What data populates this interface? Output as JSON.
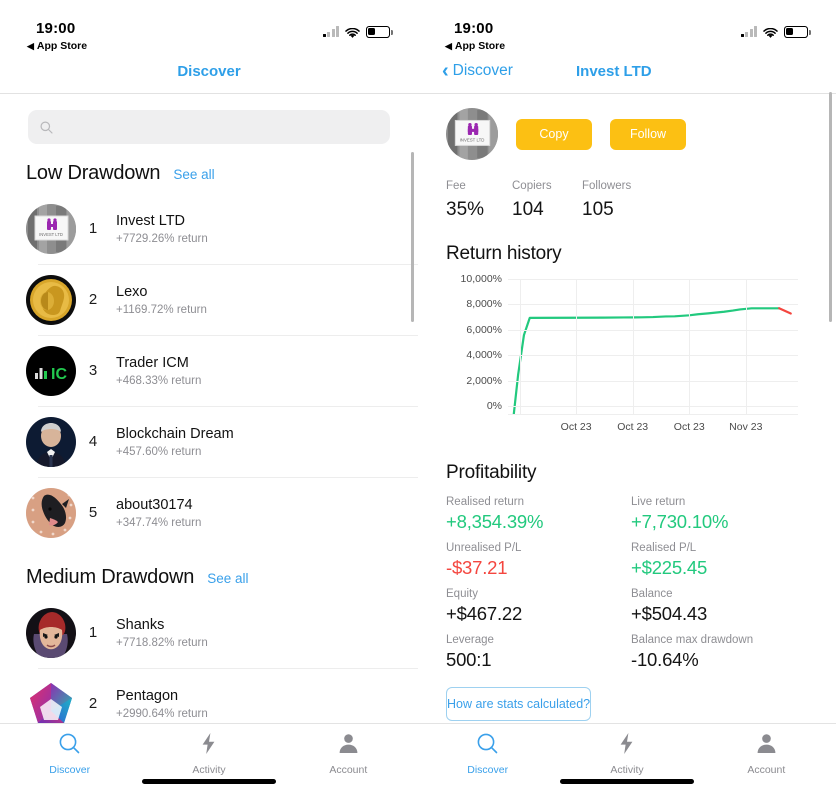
{
  "status_bar": {
    "time": "19:00",
    "back_label": "App Store",
    "back_glyph": "◀"
  },
  "left": {
    "nav_title": "Discover",
    "search": {
      "placeholder": "",
      "value": "",
      "icon": "search-icon"
    },
    "sections": [
      {
        "title": "Low Drawdown",
        "see_all": "See all",
        "items": [
          {
            "rank": "1",
            "name": "Invest LTD",
            "return": "+7729.26% return",
            "avatar": "invest-ltd-logo"
          },
          {
            "rank": "2",
            "name": "Lexo",
            "return": "+1169.72% return",
            "avatar": "gold-coin"
          },
          {
            "rank": "3",
            "name": "Trader ICM",
            "return": "+468.33% return",
            "avatar": "trader-icm-logo"
          },
          {
            "rank": "4",
            "name": "Blockchain Dream",
            "return": "+457.60% return",
            "avatar": "man-portrait"
          },
          {
            "rank": "5",
            "name": "about30174",
            "return": "+347.74% return",
            "avatar": "dog-photo"
          }
        ]
      },
      {
        "title": "Medium Drawdown",
        "see_all": "See all",
        "items": [
          {
            "rank": "1",
            "name": "Shanks",
            "return": "+7718.82% return",
            "avatar": "anime-character"
          },
          {
            "rank": "2",
            "name": "Pentagon",
            "return": "+2990.64% return",
            "avatar": "pentagon-logo"
          }
        ]
      }
    ]
  },
  "right": {
    "nav_back": "Discover",
    "nav_title": "Invest LTD",
    "profile": {
      "avatar": "invest-ltd-logo",
      "copy_label": "Copy",
      "follow_label": "Follow"
    },
    "stats": [
      {
        "key": "Fee",
        "value": "35%"
      },
      {
        "key": "Copiers",
        "value": "104"
      },
      {
        "key": "Followers",
        "value": "105"
      }
    ],
    "return_history_title": "Return history",
    "profitability_title": "Profitability",
    "profitability": [
      {
        "key": "Realised return",
        "value": "+8,354.39%",
        "tone": "green"
      },
      {
        "key": "Live return",
        "value": "+7,730.10%",
        "tone": "green"
      },
      {
        "key": "Unrealised P/L",
        "value": "-$37.21",
        "tone": "red"
      },
      {
        "key": "Realised P/L",
        "value": "+$225.45",
        "tone": "green"
      },
      {
        "key": "Equity",
        "value": "+$467.22",
        "tone": "dark"
      },
      {
        "key": "Balance",
        "value": "+$504.43",
        "tone": "dark"
      },
      {
        "key": "Leverage",
        "value": "500:1",
        "tone": "dark"
      },
      {
        "key": "Balance max drawdown",
        "value": "-10.64%",
        "tone": "dark"
      }
    ],
    "stats_button": "How are stats calculated?"
  },
  "tabbar": {
    "items": [
      {
        "label": "Discover",
        "icon": "search-icon",
        "active": true
      },
      {
        "label": "Activity",
        "icon": "bolt-icon",
        "active": false
      },
      {
        "label": "Account",
        "icon": "person-icon",
        "active": false
      }
    ]
  },
  "colors": {
    "accent_blue": "#3aa0ea",
    "yellow_button": "#fcc013",
    "green": "#22c97e",
    "red": "#f4463f",
    "muted": "#8e8e93"
  },
  "chart_data": {
    "type": "line",
    "title": "Return history",
    "xlabel": "",
    "ylabel": "",
    "ylim": [
      -600,
      10000
    ],
    "yticks": [
      0,
      2000,
      4000,
      6000,
      8000,
      10000
    ],
    "ytick_labels": [
      "0%",
      "2,000%",
      "4,000%",
      "6,000%",
      "8,000%",
      "10,000%"
    ],
    "xtick_labels": [
      "Oct 23",
      "Oct 23",
      "Oct 23",
      "Nov 23"
    ],
    "xtick_positions": [
      0.235,
      0.43,
      0.625,
      0.82
    ],
    "grid": true,
    "legend": false,
    "series": [
      {
        "name": "Return",
        "color": "#22c97e",
        "x": [
          0.02,
          0.035,
          0.055,
          0.075,
          0.22,
          0.33,
          0.4,
          0.46,
          0.5,
          0.545,
          0.575,
          0.6,
          0.625,
          0.655,
          0.69,
          0.715,
          0.745,
          0.775,
          0.8,
          0.84,
          0.9,
          0.935
        ],
        "y": [
          -600,
          2500,
          5600,
          6950,
          6960,
          6970,
          6980,
          6990,
          7010,
          7060,
          7070,
          7110,
          7150,
          7230,
          7300,
          7360,
          7430,
          7520,
          7610,
          7700,
          7700,
          7700
        ]
      },
      {
        "name": "Drawdown",
        "color": "#f4463f",
        "x": [
          0.935,
          0.955,
          0.975
        ],
        "y": [
          7700,
          7500,
          7290
        ]
      }
    ]
  }
}
